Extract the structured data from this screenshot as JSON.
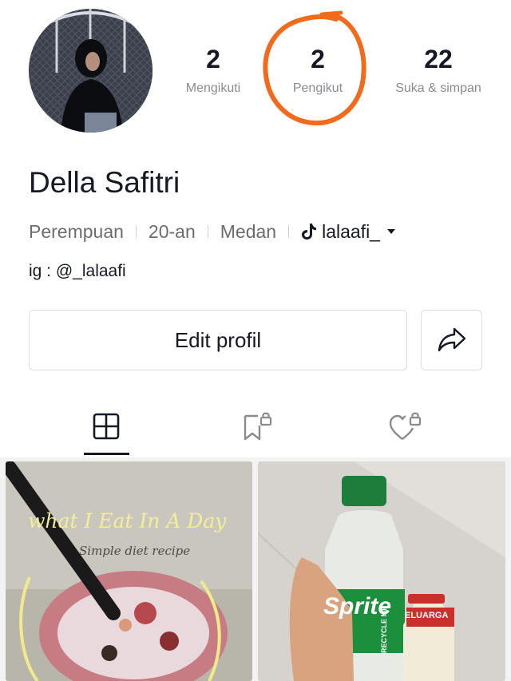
{
  "profile": {
    "name": "Della Safitri",
    "gender": "Perempuan",
    "age": "20-an",
    "city": "Medan",
    "tiktok_handle": "lalaafi_",
    "bio": "ig : @_lalaafi"
  },
  "stats": [
    {
      "value": "2",
      "label": "Mengikuti"
    },
    {
      "value": "2",
      "label": "Pengikut"
    },
    {
      "value": "22",
      "label": "Suka & simpan"
    }
  ],
  "actions": {
    "edit_label": "Edit profil"
  },
  "tabs": [
    {
      "icon": "grid-icon",
      "active": true
    },
    {
      "icon": "bookmark-lock-icon",
      "active": false
    },
    {
      "icon": "heart-lock-icon",
      "active": false
    }
  ],
  "posts": [
    {
      "title_overlay": "what I Eat In A Day",
      "subtitle_overlay": "Simple diet recipe"
    },
    {
      "bottle_label": "Sprite",
      "bottle_side_text": "RECYCLE ME",
      "small_bottle_label": "ELUARGA"
    }
  ],
  "annotation": {
    "color": "#f26a1b"
  },
  "colors": {
    "text": "#161823",
    "muted": "#8a8b91",
    "border": "#dcdce0"
  }
}
